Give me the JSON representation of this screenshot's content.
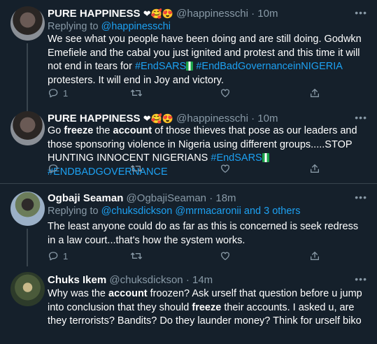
{
  "tweets": [
    {
      "name": "PURE HAPPINESS",
      "emojis": "❤🥰😍",
      "handle": "@happinesschi",
      "time": "· 10m",
      "reply_prefix": "Replying to",
      "reply_to": "@happinesschi",
      "text_1": "We see what you people have been doing and are still doing. Godwkn Emefiele and the cabal you just ignited and protest and this time it will not end in tears for",
      "tag_1": "#EndSARS",
      "tag_2": "#EndBadGovernanceinNIGERIA",
      "text_2": "protesters.  It will end in Joy and victory.",
      "reply_count": "1"
    },
    {
      "name": "PURE HAPPINESS",
      "emojis": "❤🥰😍",
      "handle": "@happinesschi",
      "time": "· 10m",
      "w_go": "Go",
      "w_freeze": "freeze",
      "w_the": "the",
      "w_account": "account",
      "text_rest": "of those thieves that pose as our leaders and those sponsoring violence in Nigeria using different groups.....STOP HUNTING INNOCENT NIGERIANS",
      "tag_1": "#EndSARS",
      "tag_2": "#ENDBADGOVERNANCE"
    },
    {
      "name": "Ogbaji Seaman",
      "handle": "@OgbajiSeaman",
      "time": "· 18m",
      "reply_prefix": "Replying to",
      "reply_to": "@chuksdickson @mrmacaronii and 3 others",
      "text": "The least anyone could do as far as this is concerned is seek redress in a law court...that's how the system works.",
      "reply_count": "1"
    },
    {
      "name": "Chuks Ikem",
      "handle": "@chuksdickson",
      "time": "· 14m",
      "t1": "Why was the",
      "w_account": "account",
      "t2": "froozen? Ask urself that question before u jump into conclusion that they should",
      "w_freeze": "freeze",
      "t3": "their accounts. I asked u, are they terrorists? Bandits? Do they launder money? Think for urself biko"
    }
  ],
  "icons": [
    "reply-icon",
    "retweet-icon",
    "like-icon",
    "share-icon",
    "more-icon"
  ],
  "colors": {
    "background": "#15202b",
    "link": "#1da1f2",
    "muted": "#8899a6",
    "divider": "#38444d"
  }
}
